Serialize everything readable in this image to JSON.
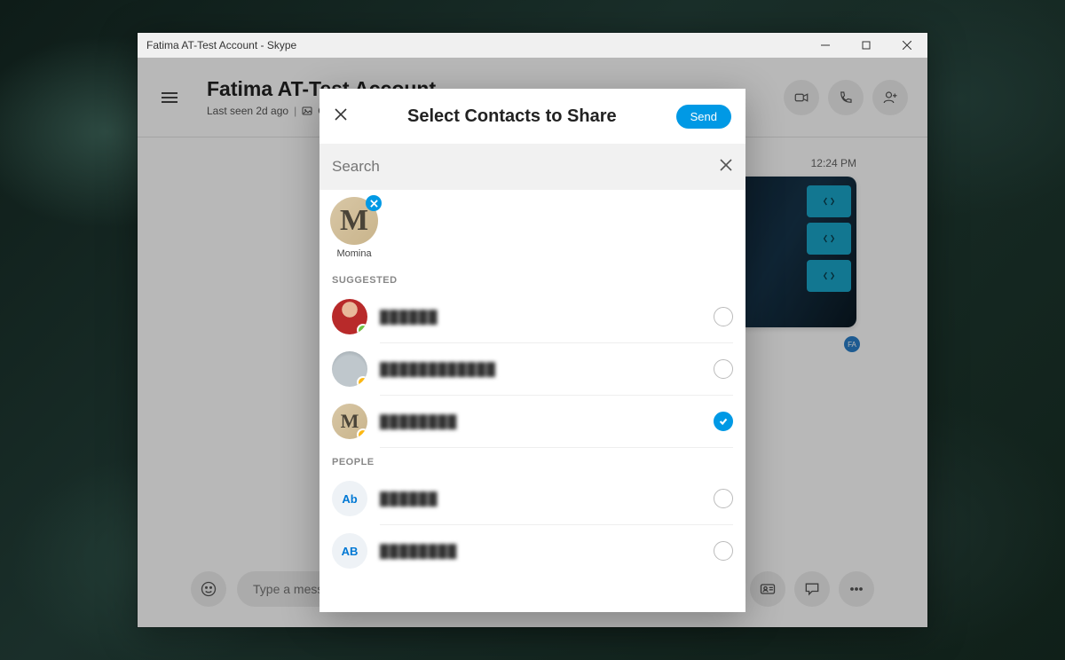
{
  "window": {
    "title": "Fatima AT-Test Account - Skype"
  },
  "chat": {
    "title": "Fatima AT-Test Account",
    "last_seen": "Last seen 2d ago",
    "separator": "|",
    "gallery_label": "Gallery",
    "timestamp": "12:24 PM",
    "fa_badge": "FA"
  },
  "composer": {
    "placeholder": "Type a message"
  },
  "modal": {
    "title": "Select Contacts to Share",
    "send_label": "Send",
    "search_placeholder": "Search",
    "selected_chip": {
      "name": "Momina"
    },
    "sections": {
      "suggested_label": "SUGGESTED",
      "people_label": "PEOPLE"
    },
    "suggested": [
      {
        "name": "██████",
        "status": "online",
        "checked": false,
        "avatar": "red"
      },
      {
        "name": "████████████",
        "status": "away",
        "checked": false,
        "avatar": "grey"
      },
      {
        "name": "████████",
        "status": "away",
        "checked": true,
        "avatar": "M"
      }
    ],
    "people": [
      {
        "initials": "Ab",
        "name": "██████",
        "checked": false
      },
      {
        "initials": "AB",
        "name": "████████",
        "checked": false
      }
    ]
  }
}
